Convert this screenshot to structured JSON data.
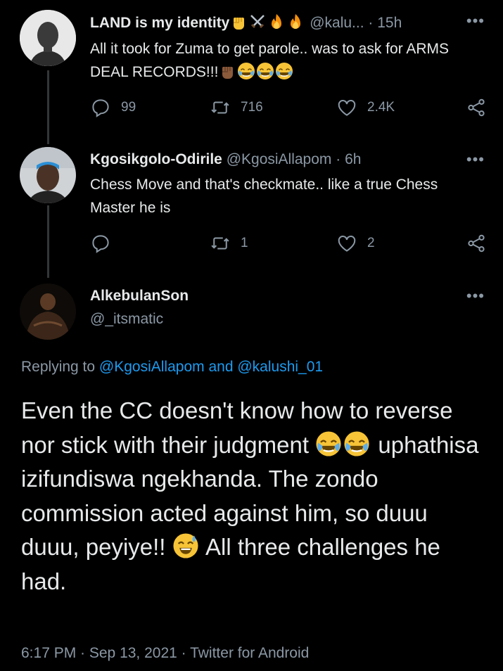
{
  "tweets": [
    {
      "display_name": "LAND is my identity",
      "name_emojis": [
        "raised-fist-emoji",
        "crossed-swords-emoji",
        "fire-emoji",
        "fire-emoji"
      ],
      "handle": "@kalu...",
      "time": "· 15h",
      "text": "All it took for Zuma to get parole.. was to ask for ARMS DEAL RECORDS!!!",
      "text_emojis": [
        "raised-fist-emoji",
        "tears-of-joy-emoji",
        "tears-of-joy-emoji",
        "tears-of-joy-emoji"
      ],
      "replies": "99",
      "retweets": "716",
      "likes": "2.4K"
    },
    {
      "display_name": "Kgosikgolo-Odirile",
      "handle": "@KgosiAllapom",
      "time": "· 6h",
      "text": "Chess Move and that's checkmate.. like a true Chess Master he is",
      "replies": "",
      "retweets": "1",
      "likes": "2"
    }
  ],
  "focus_tweet": {
    "display_name": "AlkebulanSon",
    "handle": "@_itsmatic",
    "replying_prefix": "Replying to",
    "replying_to_1": "@KgosiAllapom",
    "replying_and": "and",
    "replying_to_2": "@kalushi_01",
    "text_part1": "Even the CC doesn't know how to reverse nor stick with their judgment",
    "text_part2": "uphathisa izifundiswa ngekhanda. The zondo commission acted against him, so duuu duuu, peyiye!!",
    "text_part3": "All three challenges he had.",
    "timestamp": "6:17 PM · Sep 13, 2021 · Twitter for Android"
  },
  "colors": {
    "background": "#000000",
    "text": "#e7e9ea",
    "secondary": "#8b98a5",
    "link": "#1d9bf0"
  }
}
